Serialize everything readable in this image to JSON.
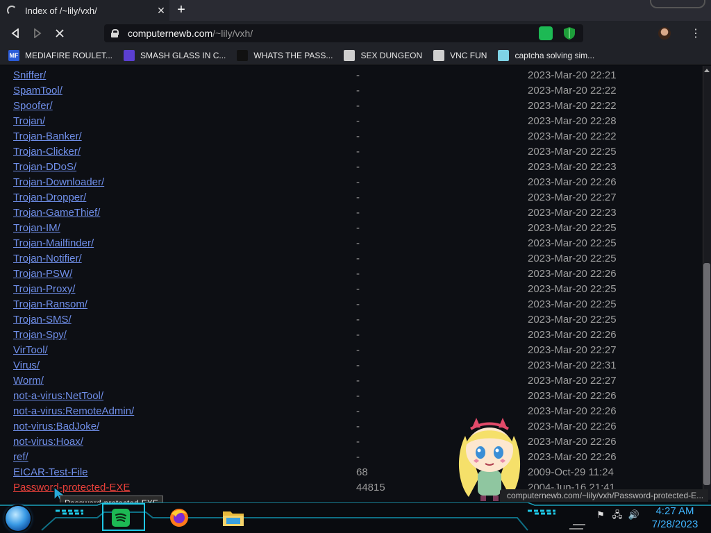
{
  "browser": {
    "tab_title": "Index of /~lily/vxh/",
    "tab_close": "✕",
    "new_tab": "+",
    "url_host": "computernewb.com",
    "url_path": "/~lily/vxh/",
    "menu_glyph": "⋮"
  },
  "bookmarks": [
    {
      "label": "MEDIAFIRE ROULET...",
      "icon": "mediafire-icon",
      "color": "#2a5bd7",
      "badge": "MF"
    },
    {
      "label": "SMASH GLASS IN C...",
      "icon": "visual-studio-icon",
      "color": "#5b3fd1",
      "badge": ""
    },
    {
      "label": "WHATS THE PASS...",
      "icon": "page-icon",
      "color": "#111111",
      "badge": ""
    },
    {
      "label": "SEX DUNGEON",
      "icon": "gear-icon",
      "color": "#cfcfcf",
      "badge": ""
    },
    {
      "label": "VNC FUN",
      "icon": "gear-icon",
      "color": "#cfcfcf",
      "badge": ""
    },
    {
      "label": "captcha solving sim...",
      "icon": "a-logo-icon",
      "color": "#7fd3e6",
      "badge": ""
    }
  ],
  "listing": [
    {
      "name": "Sniffer/",
      "size": "-",
      "date": "2023-Mar-20 22:21"
    },
    {
      "name": "SpamTool/",
      "size": "-",
      "date": "2023-Mar-20 22:22"
    },
    {
      "name": "Spoofer/",
      "size": "-",
      "date": "2023-Mar-20 22:22"
    },
    {
      "name": "Trojan/",
      "size": "-",
      "date": "2023-Mar-20 22:28"
    },
    {
      "name": "Trojan-Banker/",
      "size": "-",
      "date": "2023-Mar-20 22:22"
    },
    {
      "name": "Trojan-Clicker/",
      "size": "-",
      "date": "2023-Mar-20 22:25"
    },
    {
      "name": "Trojan-DDoS/",
      "size": "-",
      "date": "2023-Mar-20 22:23"
    },
    {
      "name": "Trojan-Downloader/",
      "size": "-",
      "date": "2023-Mar-20 22:26"
    },
    {
      "name": "Trojan-Dropper/",
      "size": "-",
      "date": "2023-Mar-20 22:27"
    },
    {
      "name": "Trojan-GameThief/",
      "size": "-",
      "date": "2023-Mar-20 22:23"
    },
    {
      "name": "Trojan-IM/",
      "size": "-",
      "date": "2023-Mar-20 22:25"
    },
    {
      "name": "Trojan-Mailfinder/",
      "size": "-",
      "date": "2023-Mar-20 22:25"
    },
    {
      "name": "Trojan-Notifier/",
      "size": "-",
      "date": "2023-Mar-20 22:25"
    },
    {
      "name": "Trojan-PSW/",
      "size": "-",
      "date": "2023-Mar-20 22:26"
    },
    {
      "name": "Trojan-Proxy/",
      "size": "-",
      "date": "2023-Mar-20 22:25"
    },
    {
      "name": "Trojan-Ransom/",
      "size": "-",
      "date": "2023-Mar-20 22:25"
    },
    {
      "name": "Trojan-SMS/",
      "size": "-",
      "date": "2023-Mar-20 22:25"
    },
    {
      "name": "Trojan-Spy/",
      "size": "-",
      "date": "2023-Mar-20 22:26"
    },
    {
      "name": "VirTool/",
      "size": "-",
      "date": "2023-Mar-20 22:27"
    },
    {
      "name": "Virus/",
      "size": "-",
      "date": "2023-Mar-20 22:31"
    },
    {
      "name": "Worm/",
      "size": "-",
      "date": "2023-Mar-20 22:27"
    },
    {
      "name": "not-a-virus:NetTool/",
      "size": "-",
      "date": "2023-Mar-20 22:26"
    },
    {
      "name": "not-a-virus:RemoteAdmin/",
      "size": "-",
      "date": "2023-Mar-20 22:26"
    },
    {
      "name": "not-virus:BadJoke/",
      "size": "-",
      "date": "2023-Mar-20 22:26"
    },
    {
      "name": "not-virus:Hoax/",
      "size": "-",
      "date": "2023-Mar-20 22:26"
    },
    {
      "name": "ref/",
      "size": "-",
      "date": "2023-Mar-20 22:26"
    },
    {
      "name": "EICAR-Test-File",
      "size": "68",
      "date": "2009-Oct-29 11:24"
    },
    {
      "name": "Password-protected-EXE",
      "size": "44815",
      "date": "2004-Jun-16 21:41",
      "alert": true
    }
  ],
  "status_url": "computernewb.com/~lily/vxh/Password-protected-E...",
  "tooltip": "Password-protected-EXE",
  "taskbar": {
    "time": "4:27 AM",
    "date": "7/28/2023",
    "apps": [
      "spotify-icon",
      "firefox-icon",
      "file-explorer-icon"
    ]
  },
  "colors": {
    "link": "#6f8ee8",
    "link_alert": "#e8403a",
    "clock": "#3fb5ff",
    "accent_cyan": "#1fc8e6"
  }
}
